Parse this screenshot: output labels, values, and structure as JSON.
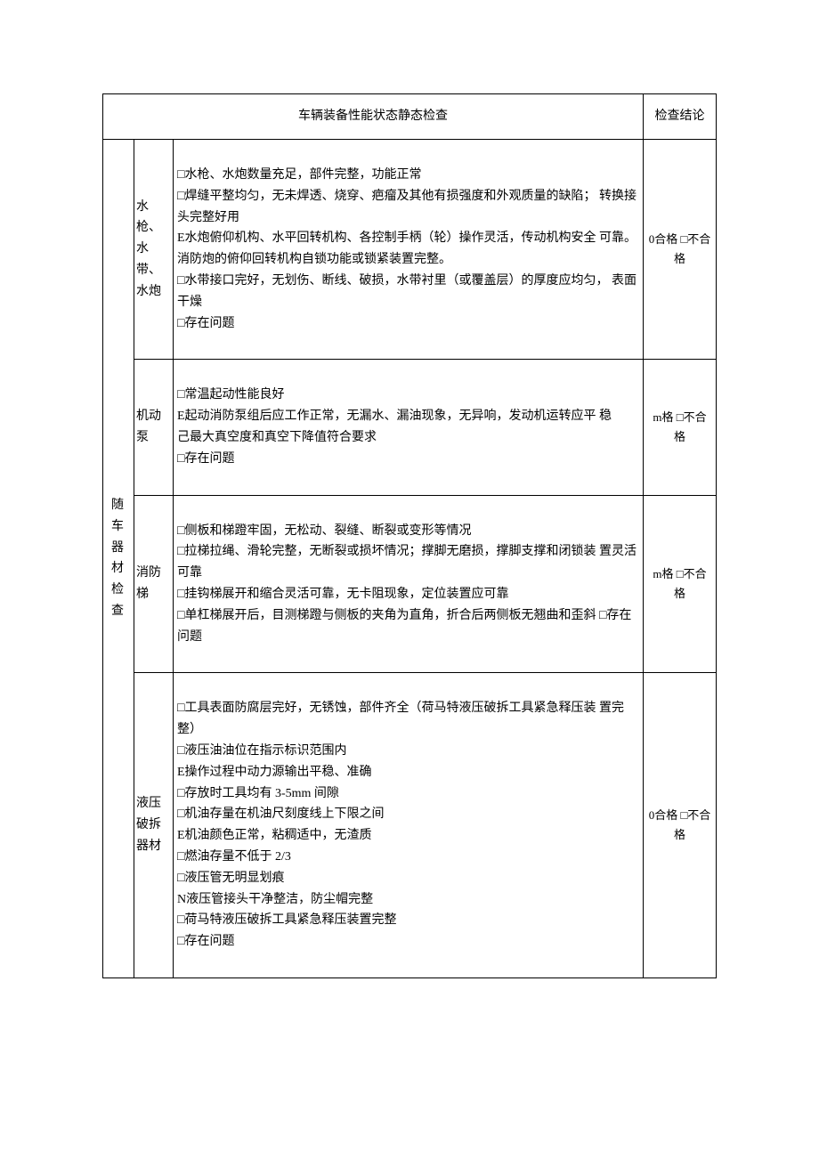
{
  "header": {
    "main": "车辆装备性能状态静态检查",
    "conclusion": "检查结论"
  },
  "category": "随 车 器 材 检 查",
  "rows": [
    {
      "sub": "水枪、 水带、 水炮",
      "content": "□水枪、水炮数量充足，部件完整，功能正常\n□焊缝平整均匀，无未焊透、烧穿、疤瘤及其他有损强度和外观质量的缺陷； 转换接头完整好用\nE水炮俯仰机构、水平回转机构、各控制手柄（轮）操作灵活，传动机构安全 可靠。消防炮的俯仰回转机构自锁功能或锁紧装置完整。\n□水带接口完好，无划伤、断线、破损，水带衬里（或覆盖层）的厚度应均匀， 表面干燥\n□存在问题",
      "conclusion": "0合格 □不合格"
    },
    {
      "sub": "机动泵",
      "content": "□常温起动性能良好\nE起动消防泵组后应工作正常，无漏水、漏油现象，无异响，发动机运转应平 稳\n己最大真空度和真空下降值符合要求\n□存在问题",
      "conclusion": "m格 □不合格"
    },
    {
      "sub": "消防梯",
      "content": "□侧板和梯蹬牢固，无松动、裂缝、断裂或变形等情况\n□拉梯拉绳、滑轮完整，无断裂或损坏情况；撑脚无磨损，撑脚支撑和闭锁装 置灵活可靠\n□挂钩梯展开和缩合灵活可靠，无卡阻现象，定位装置应可靠\n□单杠梯展开后，目测梯蹬与侧板的夹角为直角，折合后两侧板无翘曲和歪斜 □存在问题",
      "conclusion": "m格 □不合格"
    },
    {
      "sub": "液压破拆器材",
      "content": "□工具表面防腐层完好，无锈蚀，部件齐全（荷马特液压破拆工具紧急释压装 置完整）\n□液压油油位在指示标识范围内\nE操作过程中动力源输出平稳、准确\n□存放时工具均有 3-5mm 间隙\n□机油存量在机油尺刻度线上下限之间\nE机油颜色正常，粘稠适中，无渣质\n□燃油存量不低于 2/3\n□液压管无明显划痕\nN液压管接头干净整洁，防尘帽完整\n□荷马特液压破拆工具紧急释压装置完整\n□存在问题",
      "conclusion": "0合格 □不合格"
    }
  ]
}
